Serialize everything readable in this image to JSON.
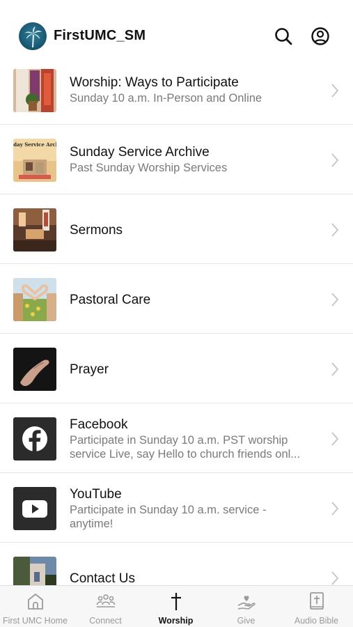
{
  "header": {
    "title": "FirstUMC_SM",
    "logo_icon": "palm-tree-logo",
    "search_icon": "search-icon",
    "profile_icon": "account-icon"
  },
  "items": [
    {
      "title": "Worship: Ways to Participate",
      "subtitle": "Sunday 10 a.m. In-Person and Online",
      "thumb": "sanctuary-banner-photo"
    },
    {
      "title": "Sunday Service Archive",
      "subtitle": "Past Sunday Worship Services",
      "thumb": "service-archive-graphic",
      "thumb_text": "Sunday Service Archive"
    },
    {
      "title": "Sermons",
      "subtitle": "",
      "thumb": "pulpit-photo"
    },
    {
      "title": "Pastoral Care",
      "subtitle": "",
      "thumb": "heart-hands-photo"
    },
    {
      "title": "Prayer",
      "subtitle": "",
      "thumb": "praying-hand-photo"
    },
    {
      "title": "Facebook",
      "subtitle": "Participate in Sunday 10 a.m. PST worship service Live, say Hello to church friends onl...",
      "thumb": "facebook-icon"
    },
    {
      "title": "YouTube",
      "subtitle": "Participate in Sunday 10 a.m. service - anytime!",
      "thumb": "youtube-icon"
    },
    {
      "title": "Contact Us",
      "subtitle": "",
      "thumb": "church-building-photo"
    }
  ],
  "tabs": [
    {
      "label": "First UMC Home",
      "icon": "church-home-icon",
      "active": false
    },
    {
      "label": "Connect",
      "icon": "people-group-icon",
      "active": false
    },
    {
      "label": "Worship",
      "icon": "cross-icon",
      "active": true
    },
    {
      "label": "Give",
      "icon": "heart-hand-icon",
      "active": false
    },
    {
      "label": "Audio Bible",
      "icon": "bible-icon",
      "active": false
    }
  ],
  "colors": {
    "accent": "#111111",
    "inactive": "#9a9a9a",
    "divider": "#e6e6e6",
    "subtitle": "#7a7a7a",
    "tile_dark": "#2b2b2b"
  }
}
